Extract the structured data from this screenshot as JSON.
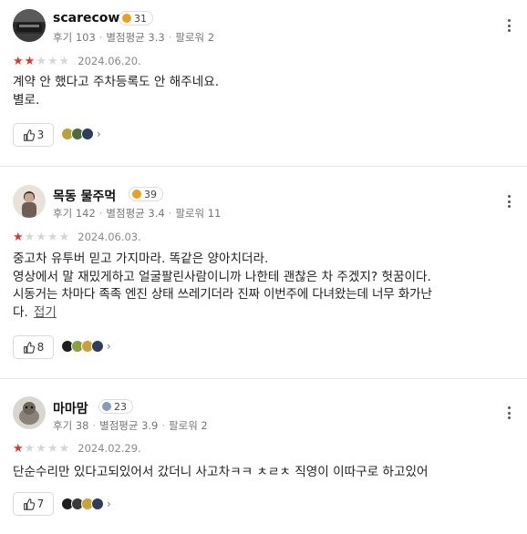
{
  "reviews": [
    {
      "name": "scarecow",
      "level": "31",
      "level_color": "#e9a21f",
      "meta": {
        "reviews": "후기 103",
        "avg": "별점평균 3.3",
        "followers": "팔로워 2"
      },
      "stars_filled": 2,
      "date": "2024.06.20.",
      "lines": [
        "계약 안 했다고 주차등록도 안 해주네요.",
        "별로."
      ],
      "fold_label": "",
      "likes": "3",
      "avatar_icon": "car-photo-avatar-icon"
    },
    {
      "name": "목동 물주먹",
      "level": "39",
      "level_color": "#e9a21f",
      "meta": {
        "reviews": "후기 142",
        "avg": "별점평균 3.4",
        "followers": "팔로워 11"
      },
      "stars_filled": 1,
      "date": "2024.06.03.",
      "lines": [
        "중고차 유투버 믿고 가지마라. 똑같은 양아치더라.",
        "영상에서 말 재밌게하고 얼굴팔린사람이니까 나한테 괜찮은 차 주겠지? 헛꿈이다.",
        "시동거는 차마다 족족 엔진 상태 쓰레기더라 진짜 이번주에 다녀왔는데 너무 화가난",
        "다."
      ],
      "fold_label": "접기",
      "likes": "8",
      "avatar_icon": "person-photo-avatar-icon"
    },
    {
      "name": "마마맘",
      "level": "23",
      "level_color": "#8a9bb8",
      "meta": {
        "reviews": "후기 38",
        "avg": "별점평균 3.9",
        "followers": "팔로워 2"
      },
      "stars_filled": 1,
      "date": "2024.02.29.",
      "lines": [
        "단순수리만 있다고되있어서 갔더니 사고차ㅋㅋ ㅊㄹㅊ 직영이 이따구로 하고있어"
      ],
      "fold_label": "",
      "likes": "7",
      "avatar_icon": "pet-photo-avatar-icon"
    }
  ],
  "colors": {
    "star_filled": "#e5332a",
    "star_empty": "#d6d6d6"
  }
}
